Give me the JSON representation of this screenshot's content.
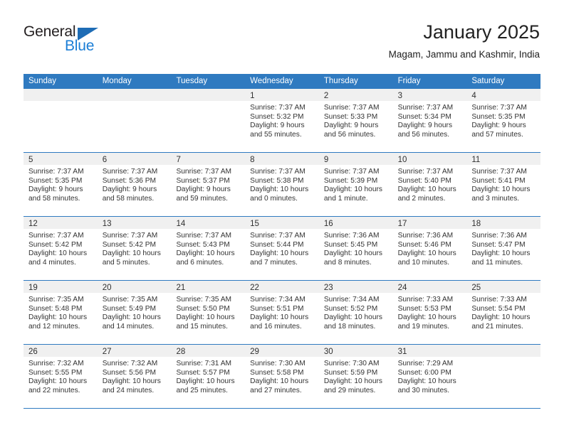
{
  "brand": {
    "name_part1": "General",
    "name_part2": "Blue",
    "triangle_color": "#1e6cb5",
    "blue_color": "#1b7ed6"
  },
  "header": {
    "title": "January 2025",
    "subtitle": "Magam, Jammu and Kashmir, India"
  },
  "theme": {
    "header_bg": "#2f7ac0",
    "header_text": "#ffffff",
    "datebar_bg": "#f0f0f0",
    "row_separator": "#2f7ac0"
  },
  "weekdays": [
    "Sunday",
    "Monday",
    "Tuesday",
    "Wednesday",
    "Thursday",
    "Friday",
    "Saturday"
  ],
  "weeks": [
    [
      {
        "day": "",
        "lines": []
      },
      {
        "day": "",
        "lines": []
      },
      {
        "day": "",
        "lines": []
      },
      {
        "day": "1",
        "lines": [
          "Sunrise: 7:37 AM",
          "Sunset: 5:32 PM",
          "Daylight: 9 hours",
          "and 55 minutes."
        ]
      },
      {
        "day": "2",
        "lines": [
          "Sunrise: 7:37 AM",
          "Sunset: 5:33 PM",
          "Daylight: 9 hours",
          "and 56 minutes."
        ]
      },
      {
        "day": "3",
        "lines": [
          "Sunrise: 7:37 AM",
          "Sunset: 5:34 PM",
          "Daylight: 9 hours",
          "and 56 minutes."
        ]
      },
      {
        "day": "4",
        "lines": [
          "Sunrise: 7:37 AM",
          "Sunset: 5:35 PM",
          "Daylight: 9 hours",
          "and 57 minutes."
        ]
      }
    ],
    [
      {
        "day": "5",
        "lines": [
          "Sunrise: 7:37 AM",
          "Sunset: 5:35 PM",
          "Daylight: 9 hours",
          "and 58 minutes."
        ]
      },
      {
        "day": "6",
        "lines": [
          "Sunrise: 7:37 AM",
          "Sunset: 5:36 PM",
          "Daylight: 9 hours",
          "and 58 minutes."
        ]
      },
      {
        "day": "7",
        "lines": [
          "Sunrise: 7:37 AM",
          "Sunset: 5:37 PM",
          "Daylight: 9 hours",
          "and 59 minutes."
        ]
      },
      {
        "day": "8",
        "lines": [
          "Sunrise: 7:37 AM",
          "Sunset: 5:38 PM",
          "Daylight: 10 hours",
          "and 0 minutes."
        ]
      },
      {
        "day": "9",
        "lines": [
          "Sunrise: 7:37 AM",
          "Sunset: 5:39 PM",
          "Daylight: 10 hours",
          "and 1 minute."
        ]
      },
      {
        "day": "10",
        "lines": [
          "Sunrise: 7:37 AM",
          "Sunset: 5:40 PM",
          "Daylight: 10 hours",
          "and 2 minutes."
        ]
      },
      {
        "day": "11",
        "lines": [
          "Sunrise: 7:37 AM",
          "Sunset: 5:41 PM",
          "Daylight: 10 hours",
          "and 3 minutes."
        ]
      }
    ],
    [
      {
        "day": "12",
        "lines": [
          "Sunrise: 7:37 AM",
          "Sunset: 5:42 PM",
          "Daylight: 10 hours",
          "and 4 minutes."
        ]
      },
      {
        "day": "13",
        "lines": [
          "Sunrise: 7:37 AM",
          "Sunset: 5:42 PM",
          "Daylight: 10 hours",
          "and 5 minutes."
        ]
      },
      {
        "day": "14",
        "lines": [
          "Sunrise: 7:37 AM",
          "Sunset: 5:43 PM",
          "Daylight: 10 hours",
          "and 6 minutes."
        ]
      },
      {
        "day": "15",
        "lines": [
          "Sunrise: 7:37 AM",
          "Sunset: 5:44 PM",
          "Daylight: 10 hours",
          "and 7 minutes."
        ]
      },
      {
        "day": "16",
        "lines": [
          "Sunrise: 7:36 AM",
          "Sunset: 5:45 PM",
          "Daylight: 10 hours",
          "and 8 minutes."
        ]
      },
      {
        "day": "17",
        "lines": [
          "Sunrise: 7:36 AM",
          "Sunset: 5:46 PM",
          "Daylight: 10 hours",
          "and 10 minutes."
        ]
      },
      {
        "day": "18",
        "lines": [
          "Sunrise: 7:36 AM",
          "Sunset: 5:47 PM",
          "Daylight: 10 hours",
          "and 11 minutes."
        ]
      }
    ],
    [
      {
        "day": "19",
        "lines": [
          "Sunrise: 7:35 AM",
          "Sunset: 5:48 PM",
          "Daylight: 10 hours",
          "and 12 minutes."
        ]
      },
      {
        "day": "20",
        "lines": [
          "Sunrise: 7:35 AM",
          "Sunset: 5:49 PM",
          "Daylight: 10 hours",
          "and 14 minutes."
        ]
      },
      {
        "day": "21",
        "lines": [
          "Sunrise: 7:35 AM",
          "Sunset: 5:50 PM",
          "Daylight: 10 hours",
          "and 15 minutes."
        ]
      },
      {
        "day": "22",
        "lines": [
          "Sunrise: 7:34 AM",
          "Sunset: 5:51 PM",
          "Daylight: 10 hours",
          "and 16 minutes."
        ]
      },
      {
        "day": "23",
        "lines": [
          "Sunrise: 7:34 AM",
          "Sunset: 5:52 PM",
          "Daylight: 10 hours",
          "and 18 minutes."
        ]
      },
      {
        "day": "24",
        "lines": [
          "Sunrise: 7:33 AM",
          "Sunset: 5:53 PM",
          "Daylight: 10 hours",
          "and 19 minutes."
        ]
      },
      {
        "day": "25",
        "lines": [
          "Sunrise: 7:33 AM",
          "Sunset: 5:54 PM",
          "Daylight: 10 hours",
          "and 21 minutes."
        ]
      }
    ],
    [
      {
        "day": "26",
        "lines": [
          "Sunrise: 7:32 AM",
          "Sunset: 5:55 PM",
          "Daylight: 10 hours",
          "and 22 minutes."
        ]
      },
      {
        "day": "27",
        "lines": [
          "Sunrise: 7:32 AM",
          "Sunset: 5:56 PM",
          "Daylight: 10 hours",
          "and 24 minutes."
        ]
      },
      {
        "day": "28",
        "lines": [
          "Sunrise: 7:31 AM",
          "Sunset: 5:57 PM",
          "Daylight: 10 hours",
          "and 25 minutes."
        ]
      },
      {
        "day": "29",
        "lines": [
          "Sunrise: 7:30 AM",
          "Sunset: 5:58 PM",
          "Daylight: 10 hours",
          "and 27 minutes."
        ]
      },
      {
        "day": "30",
        "lines": [
          "Sunrise: 7:30 AM",
          "Sunset: 5:59 PM",
          "Daylight: 10 hours",
          "and 29 minutes."
        ]
      },
      {
        "day": "31",
        "lines": [
          "Sunrise: 7:29 AM",
          "Sunset: 6:00 PM",
          "Daylight: 10 hours",
          "and 30 minutes."
        ]
      },
      {
        "day": "",
        "lines": []
      }
    ]
  ]
}
